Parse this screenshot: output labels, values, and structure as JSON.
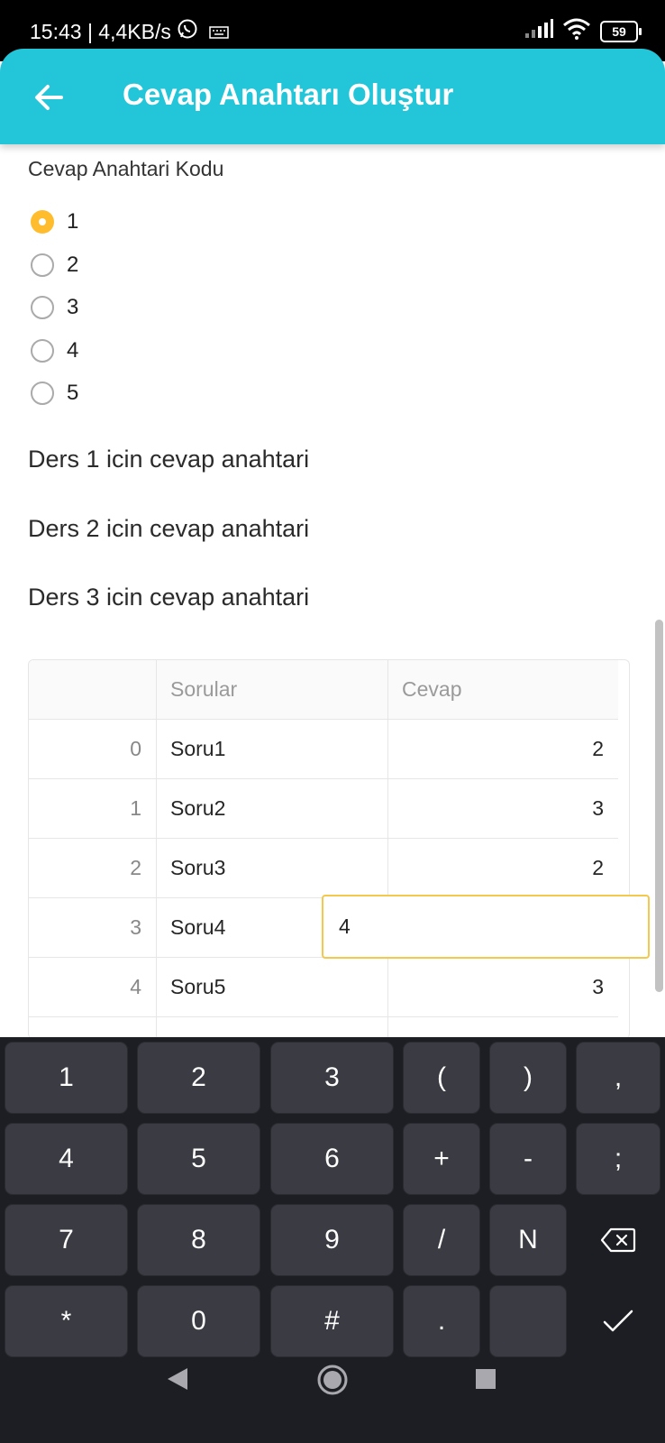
{
  "status_bar": {
    "time_speed": "15:43 | 4,4KB/s",
    "battery": "59"
  },
  "app_bar": {
    "title": "Cevap Anahtarı Oluştur"
  },
  "form": {
    "key_code_label": "Cevap Anahtari Kodu",
    "options": [
      "1",
      "2",
      "3",
      "4",
      "5"
    ],
    "selected": "1"
  },
  "lessons": [
    "Ders 1 icin cevap anahtari",
    "Ders 2 icin cevap anahtari",
    "Ders 3 icin cevap anahtari"
  ],
  "table": {
    "headers": [
      "",
      "Sorular",
      "Cevap"
    ],
    "rows": [
      {
        "idx": "0",
        "question": "Soru1",
        "answer": "2"
      },
      {
        "idx": "1",
        "question": "Soru2",
        "answer": "3"
      },
      {
        "idx": "2",
        "question": "Soru3",
        "answer": "2"
      },
      {
        "idx": "3",
        "question": "Soru4",
        "answer": ""
      },
      {
        "idx": "4",
        "question": "Soru5",
        "answer": "3"
      }
    ],
    "editing_value": "4"
  },
  "keyboard": {
    "rows": [
      [
        "1",
        "2",
        "3",
        "(",
        ")",
        ","
      ],
      [
        "4",
        "5",
        "6",
        "+",
        "-",
        ";"
      ],
      [
        "7",
        "8",
        "9",
        "/",
        "N",
        ""
      ],
      [
        "*",
        "0",
        "#",
        ".",
        "",
        ""
      ]
    ]
  },
  "icons": {
    "back": "arrow-left-icon",
    "whatsapp": "whatsapp-icon",
    "keyboard_status": "keyboard-icon",
    "signal": "signal-icon",
    "wifi": "wifi-icon",
    "backspace": "backspace-icon",
    "done": "check-icon",
    "nav_back": "triangle-back-icon",
    "nav_home": "circle-home-icon",
    "nav_recents": "square-recents-icon"
  },
  "colors": {
    "app_bar": "#23c5d9",
    "accent": "#ffbd2e",
    "edit_border": "#f3c84b",
    "keyboard_bg": "#1d1e24",
    "key_bg": "#3a3b43"
  }
}
